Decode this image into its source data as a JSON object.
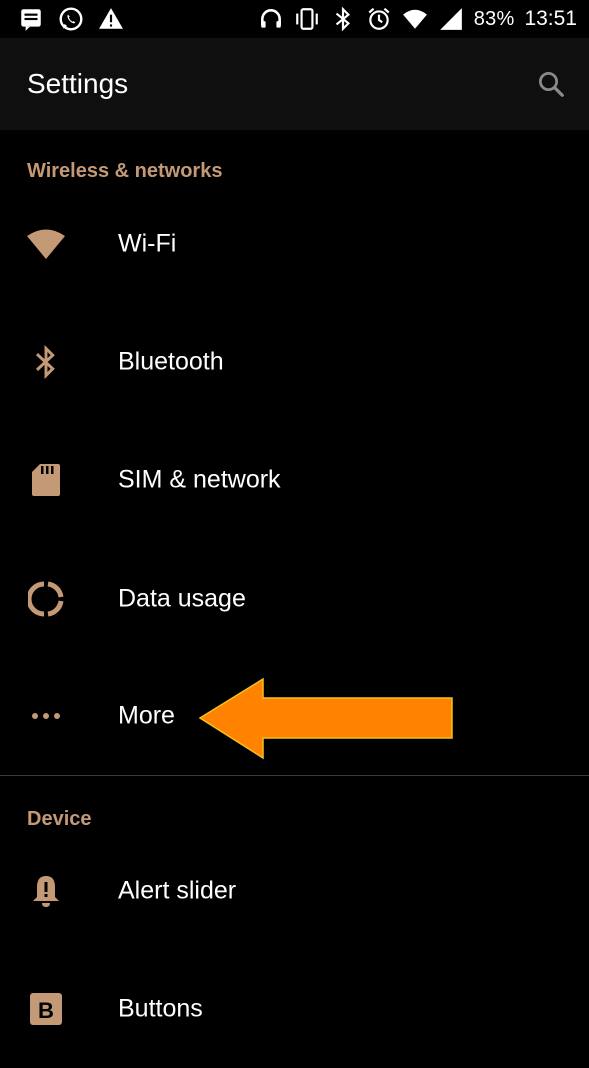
{
  "status_bar": {
    "icons_left": [
      "message-icon",
      "whatsapp-icon",
      "warning-icon"
    ],
    "icons_right": [
      "headphones-icon",
      "vibrate-icon",
      "bluetooth-icon",
      "alarm-icon",
      "wifi-icon",
      "signal-icon"
    ],
    "battery": "83%",
    "time": "13:51"
  },
  "app_bar": {
    "title": "Settings",
    "search_icon": "search-icon"
  },
  "accent_color": "#c49a76",
  "annotation_arrow_color": "#ff8200",
  "sections": [
    {
      "header": "Wireless & networks",
      "items": [
        {
          "label": "Wi-Fi",
          "icon": "wifi-icon"
        },
        {
          "label": "Bluetooth",
          "icon": "bluetooth-icon"
        },
        {
          "label": "SIM & network",
          "icon": "sim-card-icon"
        },
        {
          "label": "Data usage",
          "icon": "data-usage-icon"
        },
        {
          "label": "More",
          "icon": "more-dots-icon"
        }
      ]
    },
    {
      "header": "Device",
      "items": [
        {
          "label": "Alert slider",
          "icon": "alert-bell-icon"
        },
        {
          "label": "Buttons",
          "icon": "buttons-b-icon"
        }
      ]
    }
  ]
}
